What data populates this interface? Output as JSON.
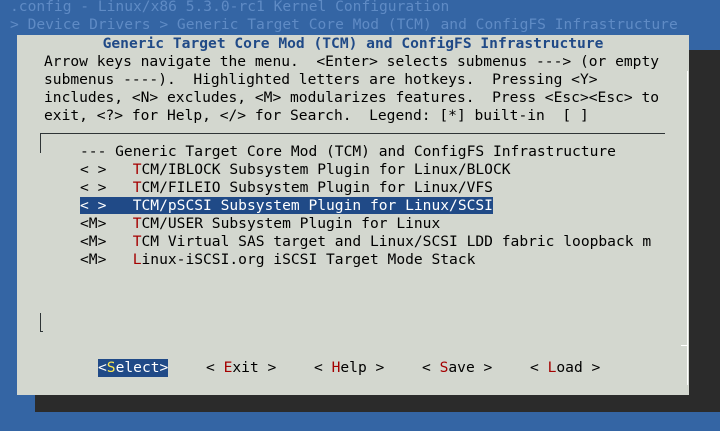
{
  "window": {
    "config_title": ".config - Linux/x86 5.3.0-rc1 Kernel Configuration",
    "breadcrumb": "> Device Drivers > Generic Target Core Mod (TCM) and ConfigFS Infrastructure"
  },
  "dialog": {
    "title": "Generic Target Core Mod (TCM) and ConfigFS Infrastructure",
    "help_lines": [
      "Arrow keys navigate the menu.  <Enter> selects submenus ---> (or empty",
      "submenus ----).  Highlighted letters are hotkeys.  Pressing <Y>",
      "includes, <N> excludes, <M> modularizes features.  Press <Esc><Esc> to",
      "exit, <?> for Help, </> for Search.  Legend: [*] built-in  [ ]"
    ]
  },
  "menu": {
    "header": "--- Generic Target Core Mod (TCM) and ConfigFS Infrastructure",
    "items": [
      {
        "state": "< >",
        "hotkey": "T",
        "rest": "CM/IBLOCK Subsystem Plugin for Linux/BLOCK"
      },
      {
        "state": "< >",
        "hotkey": "T",
        "rest": "CM/FILEIO Subsystem Plugin for Linux/VFS"
      },
      {
        "state": "< >",
        "hotkey": "T",
        "rest": "CM/pSCSI Subsystem Plugin for Linux/SCSI",
        "selected": true
      },
      {
        "state": "<M>",
        "hotkey": "T",
        "rest": "CM/USER Subsystem Plugin for Linux"
      },
      {
        "state": "<M>",
        "hotkey": "T",
        "rest": "CM Virtual SAS target and Linux/SCSI LDD fabric loopback m"
      },
      {
        "state": "<M>",
        "hotkey": "L",
        "rest": "inux-iSCSI.org iSCSI Target Mode Stack"
      }
    ]
  },
  "buttons": [
    {
      "prefix": "<",
      "hotkey": "S",
      "rest": "elect",
      "suffix": ">",
      "active": true
    },
    {
      "prefix": "< ",
      "hotkey": "E",
      "rest": "xit",
      "suffix": " >"
    },
    {
      "prefix": "< ",
      "hotkey": "H",
      "rest": "elp",
      "suffix": " >"
    },
    {
      "prefix": "< ",
      "hotkey": "S",
      "rest": "ave",
      "suffix": " >"
    },
    {
      "prefix": "< ",
      "hotkey": "L",
      "rest": "oad",
      "suffix": " >"
    }
  ]
}
